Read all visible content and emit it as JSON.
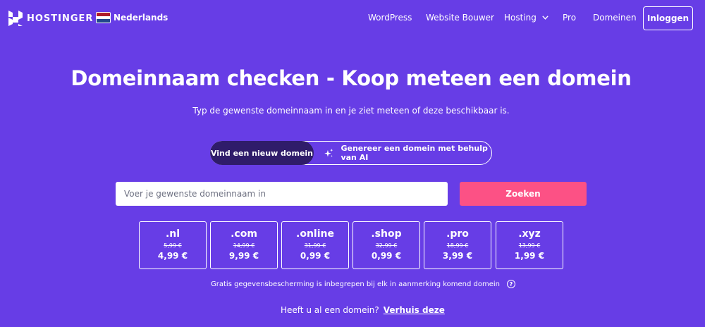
{
  "header": {
    "logo_text": "HOSTINGER",
    "language": "Nederlands",
    "nav": [
      {
        "label": "WordPress",
        "icon": ""
      },
      {
        "label": "Website Bouwer",
        "icon": ""
      },
      {
        "label": "Hosting",
        "icon": "chevron-down-icon"
      },
      {
        "label": "Pro",
        "icon": ""
      },
      {
        "label": "Domeinen",
        "icon": ""
      }
    ],
    "login_label": "Inloggen"
  },
  "hero": {
    "title": "Domeinnaam checken - Koop meteen een domein",
    "subtitle": "Typ de gewenste domeinnaam in en je ziet meteen of deze beschikbaar is."
  },
  "tabs": {
    "active": "Vind een nieuw domein",
    "ai": "Genereer een domein met behulp van AI",
    "ai_icon": "sparkle-icon"
  },
  "search": {
    "placeholder": "Voer je gewenste domeinnaam in",
    "value": "",
    "button_label": "Zoeken"
  },
  "tlds": [
    {
      "name": ".nl",
      "old_price": "5,99 €",
      "price": "4,99 €"
    },
    {
      "name": ".com",
      "old_price": "14,99 €",
      "price": "9,99 €"
    },
    {
      "name": ".online",
      "old_price": "31,99 €",
      "price": "0,99 €"
    },
    {
      "name": ".shop",
      "old_price": "32,99 €",
      "price": "0,99 €"
    },
    {
      "name": ".pro",
      "old_price": "18,99 €",
      "price": "3,99 €"
    },
    {
      "name": ".xyz",
      "old_price": "13,99 €",
      "price": "1,99 €"
    }
  ],
  "privacy": {
    "text": "Gratis gegevensbescherming is inbegrepen bij elk in aanmerking komend domein",
    "icon": "help-icon"
  },
  "transfer": {
    "question": "Heeft u al een domein?",
    "link": "Verhuis deze"
  },
  "colors": {
    "background": "#673de6",
    "accent": "#fc5185",
    "active_tab": "#2f1c6a"
  }
}
